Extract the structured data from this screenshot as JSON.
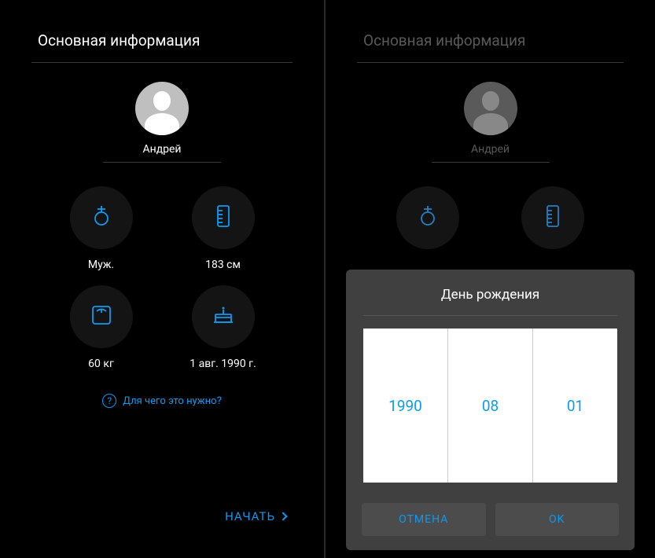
{
  "left": {
    "title": "Основная информация",
    "username": "Андрей",
    "stats": {
      "gender": "Муж.",
      "height": "183 см",
      "weight": "60 кг",
      "birthday": "1 авг. 1990 г."
    },
    "help": "Для чего это нужно?",
    "start": "НАЧАТЬ"
  },
  "right": {
    "title": "Основная информация",
    "username": "Андрей"
  },
  "dialog": {
    "title": "День рождения",
    "year": "1990",
    "month": "08",
    "day": "01",
    "cancel": "ОТМЕНА",
    "ok": "OK"
  }
}
